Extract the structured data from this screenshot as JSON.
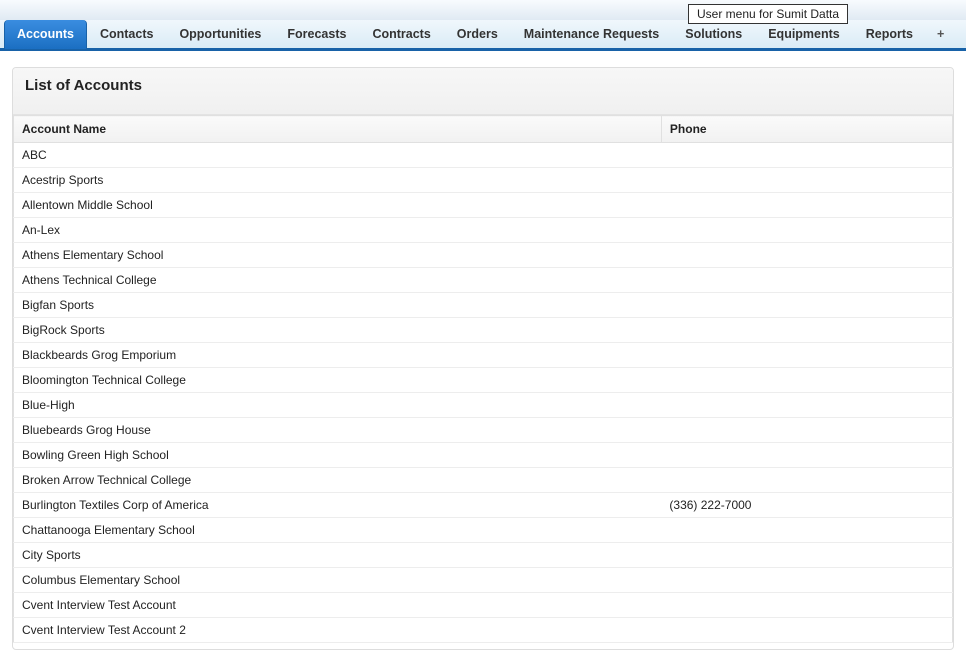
{
  "user_menu": {
    "label": "User menu for Sumit Datta"
  },
  "nav": {
    "tabs": [
      {
        "label": "Accounts",
        "active": true
      },
      {
        "label": "Contacts"
      },
      {
        "label": "Opportunities"
      },
      {
        "label": "Forecasts"
      },
      {
        "label": "Contracts"
      },
      {
        "label": "Orders"
      },
      {
        "label": "Maintenance Requests"
      },
      {
        "label": "Solutions"
      },
      {
        "label": "Equipments"
      },
      {
        "label": "Reports"
      }
    ],
    "plus_label": "+"
  },
  "page": {
    "title": "List of Accounts",
    "columns": {
      "name": "Account Name",
      "phone": "Phone"
    },
    "rows": [
      {
        "name": "ABC",
        "phone": ""
      },
      {
        "name": "Acestrip Sports",
        "phone": ""
      },
      {
        "name": "Allentown Middle School",
        "phone": ""
      },
      {
        "name": "An-Lex",
        "phone": ""
      },
      {
        "name": "Athens Elementary School",
        "phone": ""
      },
      {
        "name": "Athens Technical College",
        "phone": ""
      },
      {
        "name": "Bigfan Sports",
        "phone": ""
      },
      {
        "name": "BigRock Sports",
        "phone": ""
      },
      {
        "name": "Blackbeards Grog Emporium",
        "phone": ""
      },
      {
        "name": "Bloomington Technical College",
        "phone": ""
      },
      {
        "name": "Blue-High",
        "phone": ""
      },
      {
        "name": "Bluebeards Grog House",
        "phone": ""
      },
      {
        "name": "Bowling Green High School",
        "phone": ""
      },
      {
        "name": "Broken Arrow Technical College",
        "phone": ""
      },
      {
        "name": "Burlington Textiles Corp of America",
        "phone": "(336) 222-7000"
      },
      {
        "name": "Chattanooga Elementary School",
        "phone": ""
      },
      {
        "name": "City Sports",
        "phone": ""
      },
      {
        "name": "Columbus Elementary School",
        "phone": ""
      },
      {
        "name": "Cvent Interview Test Account",
        "phone": ""
      },
      {
        "name": "Cvent Interview Test Account 2",
        "phone": ""
      }
    ]
  }
}
